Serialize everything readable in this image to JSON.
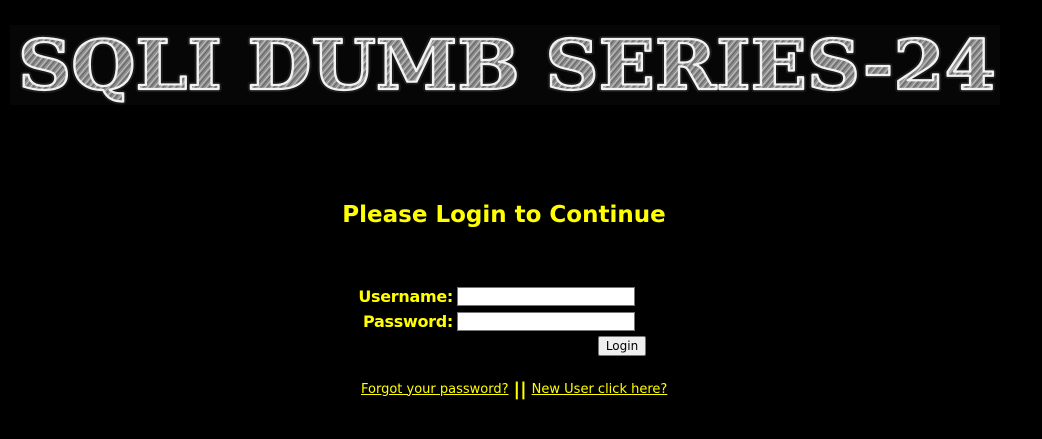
{
  "banner": {
    "text": "SQLI DUMB SERIES-24"
  },
  "heading": "Please Login to Continue",
  "form": {
    "username_label": "Username:",
    "username_value": "",
    "password_label": "Password:",
    "password_value": "",
    "login_button": "Login"
  },
  "links": {
    "forgot_password": "Forgot your password?",
    "separator": "||",
    "new_user": "New User click here?"
  },
  "colors": {
    "background": "#000000",
    "text_accent": "#ffff00",
    "banner_gray": "#8a8a8a"
  }
}
